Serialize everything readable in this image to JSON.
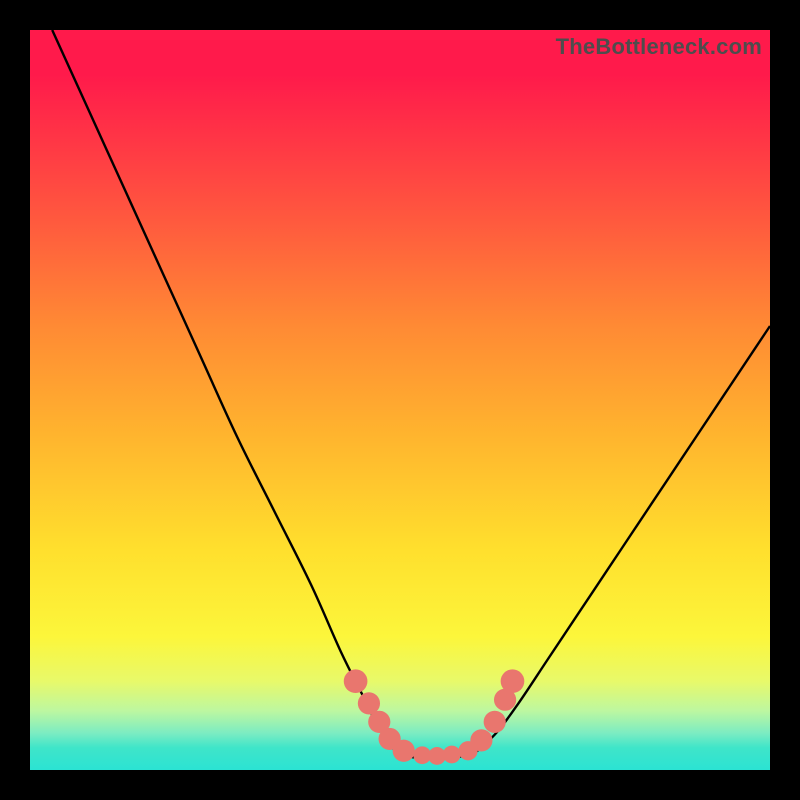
{
  "watermark": "TheBottleneck.com",
  "chart_data": {
    "type": "line",
    "title": "",
    "xlabel": "",
    "ylabel": "",
    "xlim": [
      0,
      100
    ],
    "ylim": [
      0,
      100
    ],
    "grid": false,
    "series": [
      {
        "name": "curve-left",
        "x": [
          3,
          8,
          13,
          18,
          23,
          28,
          33,
          38,
          42,
          45,
          47,
          49,
          50
        ],
        "y": [
          100,
          89,
          78,
          67,
          56,
          45,
          35,
          25,
          16,
          10,
          6,
          3,
          2
        ]
      },
      {
        "name": "valley-floor",
        "x": [
          50,
          52,
          55,
          58,
          60
        ],
        "y": [
          2,
          1.7,
          1.7,
          1.8,
          2.2
        ]
      },
      {
        "name": "curve-right",
        "x": [
          60,
          63,
          66,
          70,
          74,
          78,
          82,
          86,
          90,
          94,
          98,
          100
        ],
        "y": [
          2.2,
          5,
          9,
          15,
          21,
          27,
          33,
          39,
          45,
          51,
          57,
          60
        ]
      }
    ],
    "markers": [
      {
        "x": 44.0,
        "y": 12.0,
        "r": 1.6
      },
      {
        "x": 45.8,
        "y": 9.0,
        "r": 1.5
      },
      {
        "x": 47.2,
        "y": 6.5,
        "r": 1.5
      },
      {
        "x": 48.6,
        "y": 4.2,
        "r": 1.5
      },
      {
        "x": 50.5,
        "y": 2.6,
        "r": 1.5
      },
      {
        "x": 53.0,
        "y": 2.0,
        "r": 1.2
      },
      {
        "x": 55.0,
        "y": 1.9,
        "r": 1.2
      },
      {
        "x": 57.0,
        "y": 2.1,
        "r": 1.2
      },
      {
        "x": 59.2,
        "y": 2.6,
        "r": 1.3
      },
      {
        "x": 61.0,
        "y": 4.0,
        "r": 1.5
      },
      {
        "x": 62.8,
        "y": 6.5,
        "r": 1.5
      },
      {
        "x": 64.2,
        "y": 9.5,
        "r": 1.5
      },
      {
        "x": 65.2,
        "y": 12.0,
        "r": 1.6
      }
    ],
    "marker_color": "#e9766e",
    "line_color": "#000000",
    "background_gradient": {
      "top": "#ff1a4b",
      "mid_top": "#ff8a34",
      "mid": "#ffdf2d",
      "mid_bottom": "#bdf7a0",
      "bottom": "#2be3d3"
    }
  }
}
